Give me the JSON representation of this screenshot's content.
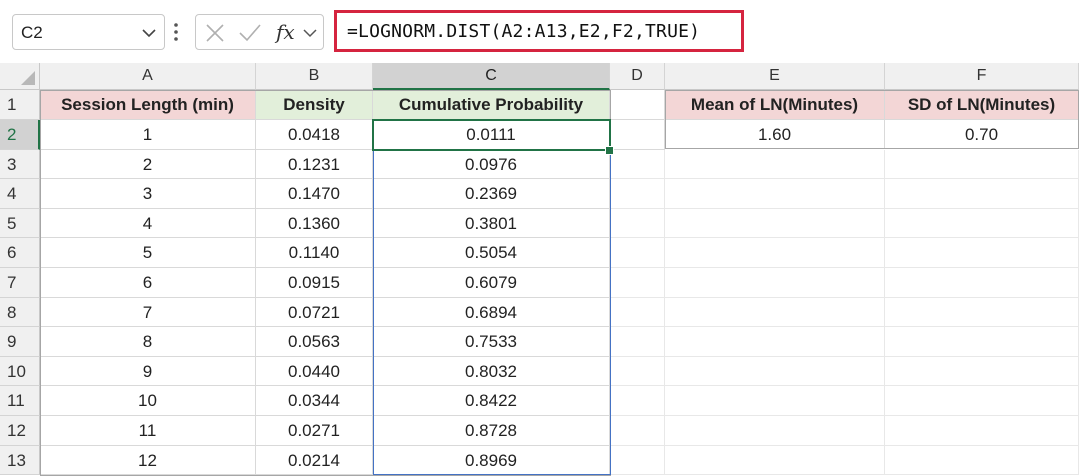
{
  "formula_bar": {
    "name_box": "C2",
    "formula": "=LOGNORM.DIST(A2:A13,E2,F2,TRUE)",
    "fx_label": "fx"
  },
  "columns": [
    "A",
    "B",
    "C",
    "D",
    "E",
    "F"
  ],
  "rows": [
    "1",
    "2",
    "3",
    "4",
    "5",
    "6",
    "7",
    "8",
    "9",
    "10",
    "11",
    "12",
    "13"
  ],
  "headers": {
    "a": "Session Length (min)",
    "b": "Density",
    "c": "Cumulative Probability",
    "e": "Mean of LN(Minutes)",
    "f": "SD of LN(Minutes)"
  },
  "params": {
    "mean": "1.60",
    "sd": "0.70"
  },
  "data": [
    {
      "a": "1",
      "b": "0.0418",
      "c": "0.0111"
    },
    {
      "a": "2",
      "b": "0.1231",
      "c": "0.0976"
    },
    {
      "a": "3",
      "b": "0.1470",
      "c": "0.2369"
    },
    {
      "a": "4",
      "b": "0.1360",
      "c": "0.3801"
    },
    {
      "a": "5",
      "b": "0.1140",
      "c": "0.5054"
    },
    {
      "a": "6",
      "b": "0.0915",
      "c": "0.6079"
    },
    {
      "a": "7",
      "b": "0.0721",
      "c": "0.6894"
    },
    {
      "a": "8",
      "b": "0.0563",
      "c": "0.7533"
    },
    {
      "a": "9",
      "b": "0.0440",
      "c": "0.8032"
    },
    {
      "a": "10",
      "b": "0.0344",
      "c": "0.8422"
    },
    {
      "a": "11",
      "b": "0.0271",
      "c": "0.8728"
    },
    {
      "a": "12",
      "b": "0.0214",
      "c": "0.8969"
    }
  ],
  "colors": {
    "header_pink": "#f3d6d6",
    "header_green": "#e2efda",
    "formula_highlight": "#d5243f",
    "selection_green": "#217346",
    "range_blue": "#4472c4"
  }
}
